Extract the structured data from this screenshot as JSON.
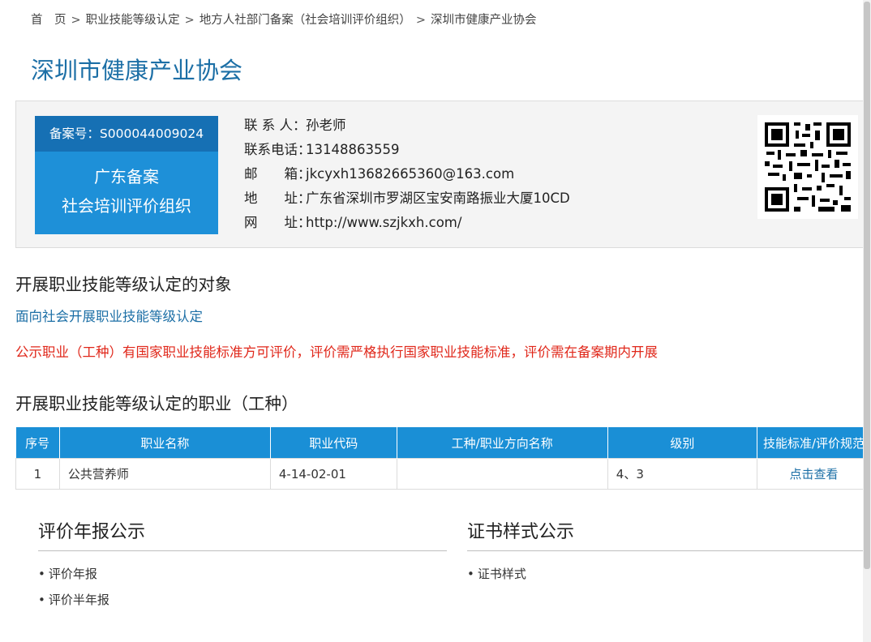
{
  "breadcrumb": [
    "首　页",
    "职业技能等级认定",
    "地方人社部门备案（社会培训评价组织）",
    "深圳市健康产业协会"
  ],
  "breadcrumb_sep": ">",
  "page_title": "深圳市健康产业协会",
  "badge": {
    "record_no": "备案号：S000044009024",
    "line1": "广东备案",
    "line2": "社会培训评价组织"
  },
  "contacts": [
    {
      "label": "联 系 人：",
      "value": "孙老师"
    },
    {
      "label": "联系电话：",
      "value": "13148863559"
    },
    {
      "label": "邮　　箱：",
      "value": "jkcyxh13682665360@163.com"
    },
    {
      "label": "地　　址：",
      "value": "广东省深圳市罗湖区宝安南路振业大厦10CD"
    },
    {
      "label": "网　　址：",
      "value": "http://www.szjkxh.com/"
    }
  ],
  "section_target": {
    "title": "开展职业技能等级认定的对象",
    "text": "面向社会开展职业技能等级认定",
    "notice": "公示职业（工种）有国家职业技能标准方可评价，评价需严格执行国家职业技能标准，评价需在备案期内开展"
  },
  "section_occupations": {
    "title": "开展职业技能等级认定的职业（工种）",
    "headers": [
      "序号",
      "职业名称",
      "职业代码",
      "工种/职业方向名称",
      "级别",
      "技能标准/评价规范"
    ],
    "rows": [
      {
        "no": "1",
        "name": "公共营养师",
        "code": "4-14-02-01",
        "direction": "",
        "level": "4、3",
        "action": "点击查看"
      }
    ]
  },
  "panel_reports": {
    "title": "评价年报公示",
    "items": [
      "评价年报",
      "评价半年报"
    ]
  },
  "panel_certs": {
    "title": "证书样式公示",
    "items": [
      "证书样式"
    ]
  },
  "colors": {
    "accent": "#1c6fa6",
    "header_bg": "#1a8fd6",
    "notice": "#e0271a"
  }
}
